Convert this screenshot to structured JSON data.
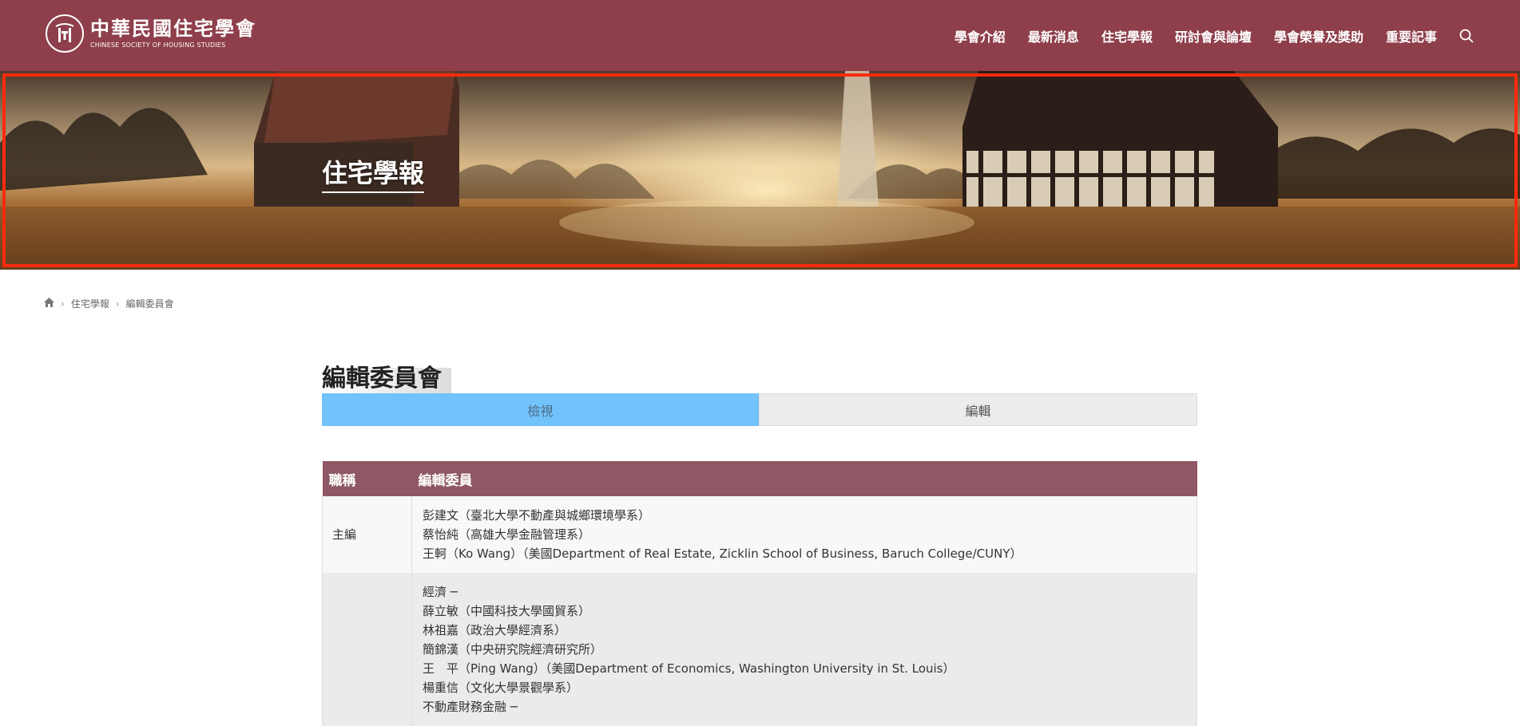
{
  "site": {
    "logo_title": "中華民國住宅學會",
    "logo_subtitle": "CHINESE SOCIETY OF HOUSING STUDIES"
  },
  "nav": {
    "items": [
      "學會介紹",
      "最新消息",
      "住宅學報",
      "研討會與論壇",
      "學會榮譽及獎助",
      "重要記事"
    ],
    "search_icon": "search-icon"
  },
  "banner": {
    "title": "住宅學報"
  },
  "breadcrumb": {
    "home_icon": "home-icon",
    "items": [
      "住宅學報",
      "編輯委員會"
    ]
  },
  "page": {
    "title": "編輯委員會",
    "tabs": [
      {
        "label": "檢視",
        "active": true
      },
      {
        "label": "編輯",
        "active": false
      }
    ]
  },
  "table": {
    "headers": [
      "職稱",
      "編輯委員"
    ],
    "rows": [
      {
        "position": "主編",
        "members": [
          "彭建文（臺北大學不動產與城鄉環境學系）",
          "蔡怡純（高雄大學金融管理系）",
          "王軻（Ko Wang）（美國Department of Real Estate, Zicklin School of Business, Baruch College/CUNY）"
        ]
      },
      {
        "position": "",
        "members": [
          "經濟 ─",
          "薛立敏（中國科技大學國貿系）",
          "林祖嘉（政治大學經濟系）",
          "簡錦漢（中央研究院經濟研究所）",
          "王　平（Ping Wang）（美國Department of Economics, Washington University in St. Louis）",
          "楊重信（文化大學景觀學系）",
          "不動產財務金融 ─"
        ]
      }
    ]
  },
  "colors": {
    "header_bg": "#8e3f4b",
    "table_header_bg": "#8e5864",
    "tab_active_bg": "#72c2fb",
    "banner_outline": "#ff2a0e"
  }
}
